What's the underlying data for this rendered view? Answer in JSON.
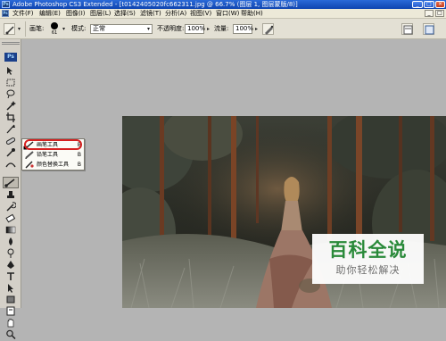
{
  "window": {
    "title": "Adobe Photoshop CS3 Extended - [t0142405020fc662311.jpg @ 66.7% (图层 1, 图层蒙版/8)]",
    "app_icon_text": "Ps",
    "buttons": {
      "minimize": "_",
      "maximize": "□",
      "close": "×"
    }
  },
  "menubar": {
    "app_icon_text": "Ps",
    "items": [
      {
        "label": "文件(F)"
      },
      {
        "label": "编辑(E)"
      },
      {
        "label": "图像(I)"
      },
      {
        "label": "图层(L)"
      },
      {
        "label": "选择(S)"
      },
      {
        "label": "滤镜(T)"
      },
      {
        "label": "分析(A)"
      },
      {
        "label": "视图(V)"
      },
      {
        "label": "窗口(W)"
      },
      {
        "label": "帮助(H)"
      }
    ],
    "mdi_buttons": {
      "minimize": "_",
      "restore": "□"
    }
  },
  "options": {
    "brush_label": "画笔:",
    "brush_size": "61",
    "mode_label": "模式:",
    "mode_value": "正常",
    "opacity_label": "不透明度:",
    "opacity_value": "100%",
    "flow_label": "流量:",
    "flow_value": "100%"
  },
  "toolbox": {
    "badge_text": "Ps",
    "tools": [
      "move-tool",
      "marquee-tool",
      "lasso-tool",
      "magic-wand-tool",
      "crop-tool",
      "slice-tool",
      "healing-brush-tool",
      "brush-tool",
      "clone-stamp-tool",
      "history-brush-tool",
      "eraser-tool",
      "gradient-tool",
      "blur-tool",
      "dodge-tool",
      "pen-tool",
      "type-tool",
      "path-selection-tool",
      "shape-tool",
      "notes-tool",
      "eyedropper-tool",
      "hand-tool",
      "zoom-tool"
    ]
  },
  "flyout": {
    "items": [
      {
        "label": "画笔工具",
        "shortcut": "B",
        "icon": "brush-icon",
        "selected": true
      },
      {
        "label": "铅笔工具",
        "shortcut": "B",
        "icon": "pencil-icon",
        "selected": false
      },
      {
        "label": "颜色替换工具",
        "shortcut": "B",
        "icon": "color-replacement-icon",
        "selected": false
      }
    ]
  },
  "watermark": {
    "title": "百科全说",
    "subtitle": "助你轻松解决",
    "color": "#2a8a3a"
  },
  "colors": {
    "titlebar": "#0f44b0",
    "menubar": "#ece9d8",
    "canvas_bg": "#b4b4b4",
    "highlight_ring": "#d62020"
  }
}
